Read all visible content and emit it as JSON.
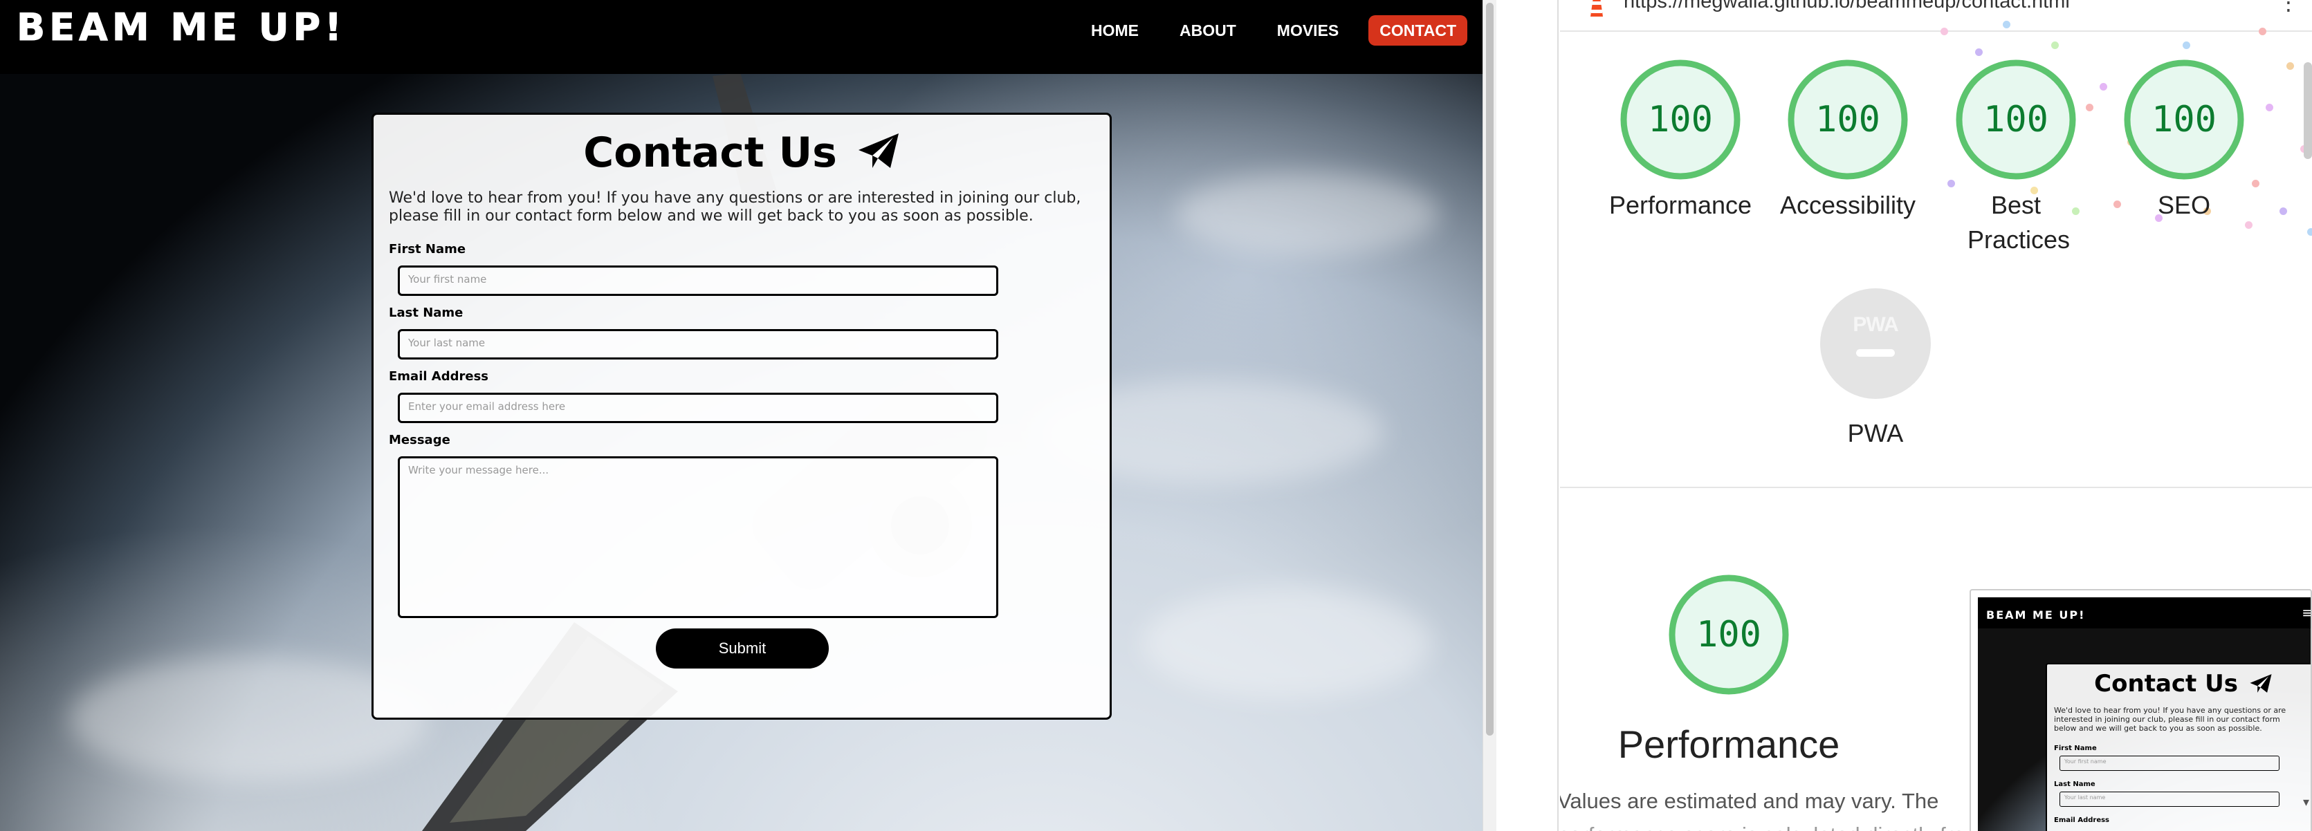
{
  "site": {
    "logo": "BEAM ME UP!",
    "nav": [
      {
        "label": "HOME",
        "active": false
      },
      {
        "label": "ABOUT",
        "active": false
      },
      {
        "label": "MOVIES",
        "active": false
      },
      {
        "label": "CONTACT",
        "active": true
      }
    ],
    "accent_color": "#d6331b",
    "contact": {
      "title": "Contact Us",
      "title_icon": "paper-plane-icon",
      "intro": "We'd love to hear from you! If you have any questions or are interested in joining our club, please fill in our contact form below and we will get back to you as soon as possible.",
      "fields": [
        {
          "label": "First Name",
          "placeholder": "Your first name"
        },
        {
          "label": "Last Name",
          "placeholder": "Your last name"
        },
        {
          "label": "Email Address",
          "placeholder": "Enter your email address here"
        },
        {
          "label": "Message",
          "placeholder": "Write your message here..."
        }
      ],
      "submit_label": "Submit"
    }
  },
  "lighthouse": {
    "url": "https://megwalla.github.io/beammeup/contact.html",
    "pass_color": "#0cce6b",
    "scores": [
      {
        "label": "Performance",
        "score": "100"
      },
      {
        "label": "Accessibility",
        "score": "100"
      },
      {
        "label": "Best Practices",
        "score": "100"
      },
      {
        "label": "SEO",
        "score": "100"
      }
    ],
    "pwa": {
      "label": "PWA",
      "badge": "PWA"
    },
    "performance_section": {
      "score": "100",
      "label": "Performance",
      "note": "Values are estimated and may vary. The",
      "note_cont": "performance score is calculated directly from"
    },
    "thumbnail": {
      "logo": "BEAM ME UP!",
      "title": "Contact Us",
      "intro": "We'd love to hear from you! If you have any questions or are interested in joining our club, please fill in our contact form below and we will get back to you as soon as possible.",
      "fields": [
        {
          "label": "First Name",
          "placeholder": "Your first name"
        },
        {
          "label": "Last Name",
          "placeholder": "Your last name"
        },
        {
          "label": "Email Address",
          "placeholder": ""
        }
      ]
    }
  }
}
